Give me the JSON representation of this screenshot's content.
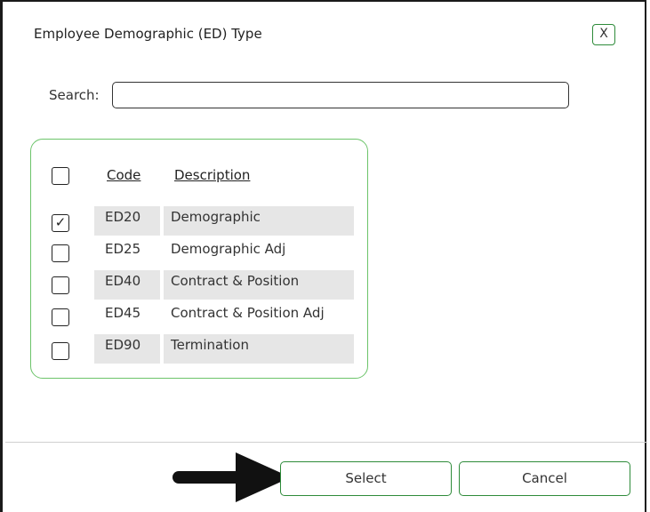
{
  "dialog": {
    "title": "Employee Demographic (ED) Type",
    "close_label": "X"
  },
  "search": {
    "label": "Search:",
    "value": ""
  },
  "table": {
    "columns": {
      "code": "Code",
      "description": "Description"
    },
    "rows": [
      {
        "code": "ED20",
        "description": "Demographic",
        "checked": "✓"
      },
      {
        "code": "ED25",
        "description": "Demographic Adj",
        "checked": ""
      },
      {
        "code": "ED40",
        "description": "Contract & Position",
        "checked": ""
      },
      {
        "code": "ED45",
        "description": "Contract & Position Adj",
        "checked": ""
      },
      {
        "code": "ED90",
        "description": "Termination",
        "checked": ""
      }
    ]
  },
  "buttons": {
    "select": "Select",
    "cancel": "Cancel"
  },
  "icons": {
    "close": "close-icon",
    "annotation": "arrow-right-icon"
  },
  "colors": {
    "accent_green": "#2e8b3a",
    "panel_border": "#6cc46a",
    "row_shade": "#e6e6e6"
  }
}
